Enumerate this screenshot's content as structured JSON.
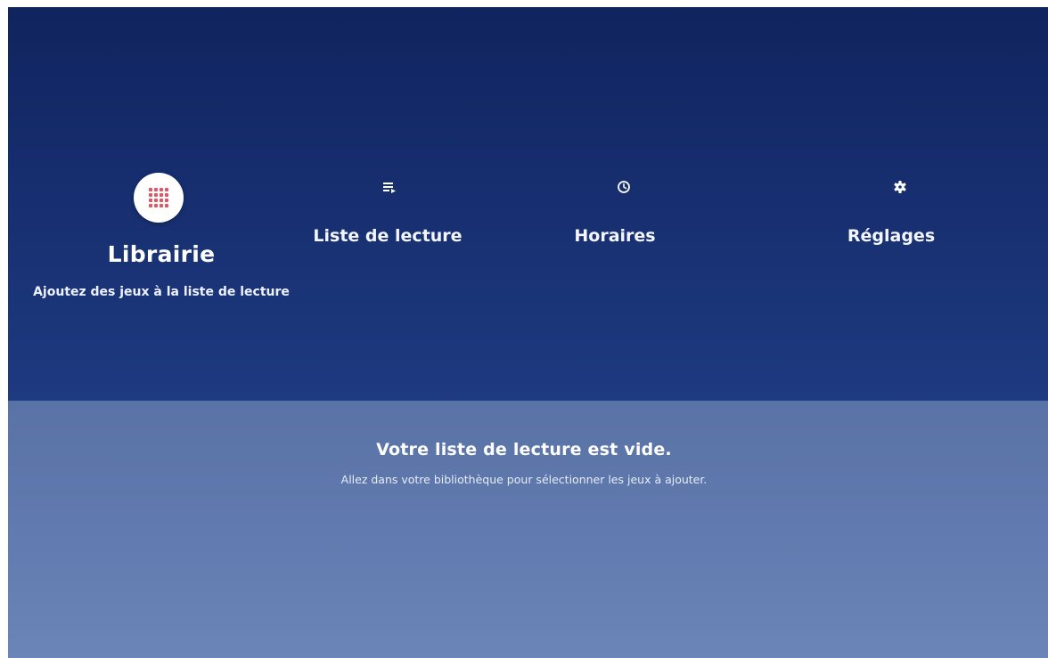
{
  "colors": {
    "top_background": "#162d6d",
    "bottom_background": "#6079ae",
    "accent_icon": "#e9535f",
    "text": "#ffffff"
  },
  "nav": {
    "items": [
      {
        "id": "librairie",
        "label": "Librairie",
        "subtitle": "Ajoutez des jeux à la liste de lecture",
        "icon": "grid-icon",
        "selected": true
      },
      {
        "id": "liste",
        "label": "Liste de lecture",
        "icon": "playlist-icon",
        "selected": false
      },
      {
        "id": "horaires",
        "label": "Horaires",
        "icon": "clock-icon",
        "selected": false
      },
      {
        "id": "reglages",
        "label": "Réglages",
        "icon": "gear-icon",
        "selected": false
      }
    ]
  },
  "empty_state": {
    "title": "Votre liste de lecture est vide.",
    "subtitle": "Allez dans votre bibliothèque pour sélectionner les jeux à ajouter."
  }
}
